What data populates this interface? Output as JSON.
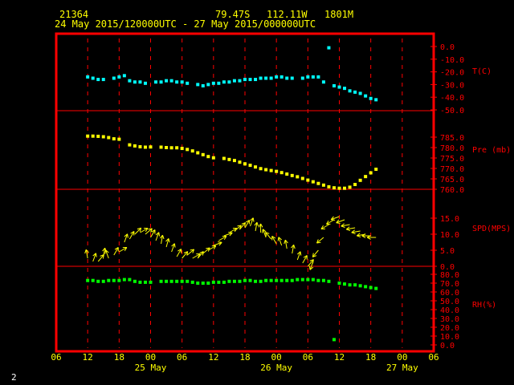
{
  "header": {
    "station": "21364",
    "lat": "79.47S",
    "lon": "112.11W",
    "elev": "1801M",
    "period": "24 May 2015/120000UTC - 27 May 2015/000000UTC"
  },
  "footer_number": "2",
  "colors": {
    "frame": "#ff0000",
    "grid": "#ff0000",
    "axis_text": "#ffff00",
    "temp": "#00ffff",
    "pressure": "#ffff00",
    "wind": "#ffff00",
    "rh": "#00ff00",
    "label_text": "#ff0000"
  },
  "chart_data": [
    {
      "type": "scatter",
      "ylabel": "T(C)",
      "ylim": [
        -50,
        0
      ],
      "yticks": [
        "0.0",
        "-10.0",
        "-20.0",
        "-30.0",
        "-40.0",
        "-50.0"
      ],
      "x": [
        12,
        13,
        14,
        15,
        17,
        18,
        19,
        20,
        21,
        22,
        23,
        25,
        26,
        27,
        28,
        29,
        30,
        31,
        33,
        34,
        35,
        36,
        37,
        38,
        39,
        40,
        41,
        42,
        43,
        44,
        45,
        46,
        47,
        48,
        49,
        50,
        51,
        53,
        54,
        55,
        56,
        57,
        58,
        59,
        60,
        61,
        62,
        63,
        64,
        65,
        66,
        67
      ],
      "y": [
        -24,
        -25,
        -26,
        -26,
        -25,
        -24,
        -23,
        -27,
        -28,
        -28,
        -29,
        -28,
        -28,
        -27,
        -27,
        -28,
        -28,
        -29,
        -30,
        -31,
        -30,
        -29,
        -29,
        -28,
        -28,
        -27,
        -27,
        -26,
        -26,
        -26,
        -25,
        -25,
        -25,
        -24,
        -24,
        -25,
        -25,
        -25,
        -24,
        -24,
        -24,
        -28,
        -1,
        -31,
        -32,
        -33,
        -35,
        -36,
        -37,
        -39,
        -41,
        -42
      ]
    },
    {
      "type": "scatter",
      "ylabel": "Pre (mb)",
      "ylim": [
        760,
        790
      ],
      "yticks": [
        "785.0",
        "780.0",
        "775.0",
        "770.0",
        "765.0",
        "760.0"
      ],
      "x": [
        12,
        13,
        14,
        15,
        16,
        17,
        18,
        20,
        21,
        22,
        23,
        24,
        26,
        27,
        28,
        29,
        30,
        31,
        32,
        33,
        34,
        35,
        36,
        38,
        39,
        40,
        41,
        42,
        43,
        44,
        45,
        46,
        47,
        48,
        49,
        50,
        51,
        52,
        53,
        54,
        55,
        56,
        57,
        58,
        59,
        60,
        61,
        62,
        63,
        64,
        65,
        66,
        67
      ],
      "y": [
        785.5,
        785.5,
        785.4,
        785.2,
        784.8,
        784.2,
        784.0,
        781.3,
        780.8,
        780.4,
        780.2,
        780.3,
        780.2,
        780.0,
        779.9,
        779.9,
        779.6,
        779.1,
        778.4,
        777.5,
        776.6,
        775.7,
        775.1,
        774.8,
        774.3,
        773.8,
        773.0,
        772.2,
        771.5,
        770.7,
        769.9,
        769.4,
        769.0,
        768.6,
        768.0,
        767.3,
        766.6,
        766.0,
        765.2,
        764.4,
        763.6,
        762.8,
        762.0,
        761.2,
        760.7,
        760.5,
        760.5,
        761.0,
        762.3,
        764.3,
        766.1,
        767.9,
        769.6
      ]
    },
    {
      "type": "scatter",
      "ylabel": "SPD(MPS)",
      "ylim": [
        0,
        18
      ],
      "yticks": [
        "15.0",
        "10.0",
        "5.0",
        "0.0"
      ],
      "x": [
        12,
        13,
        14,
        15,
        16,
        17,
        18,
        19,
        20,
        21,
        22,
        23,
        24,
        25,
        26,
        27,
        28,
        29,
        30,
        31,
        32,
        33,
        34,
        35,
        36,
        37,
        38,
        39,
        40,
        41,
        42,
        43,
        44,
        45,
        46,
        47,
        48,
        49,
        50,
        51,
        52,
        53,
        54,
        55,
        56,
        57,
        58,
        59,
        60,
        61,
        62,
        63,
        64,
        65,
        66,
        67
      ],
      "y": [
        2.5,
        1.5,
        1.5,
        3,
        2.5,
        3.5,
        4.5,
        7.5,
        8.5,
        10,
        10.5,
        10,
        9,
        8,
        7,
        6,
        4.5,
        3,
        2.5,
        3.5,
        2.5,
        2.5,
        4,
        5,
        6.5,
        8,
        9.5,
        10.5,
        11,
        11.5,
        12,
        12.5,
        11,
        10.5,
        9,
        8.5,
        7,
        6.5,
        5.5,
        4,
        2,
        1,
        0,
        1.5,
        5,
        9,
        13,
        14.5,
        15.5,
        14.5,
        13,
        12,
        11,
        10,
        9.5,
        9
      ],
      "dir": [
        350,
        20,
        40,
        10,
        340,
        30,
        60,
        20,
        30,
        45,
        60,
        50,
        30,
        20,
        10,
        15,
        20,
        30,
        40,
        50,
        60,
        40,
        50,
        60,
        70,
        60,
        70,
        60,
        50,
        40,
        30,
        20,
        10,
        0,
        340,
        320,
        330,
        340,
        350,
        10,
        20,
        30,
        40,
        200,
        220,
        230,
        240,
        240,
        250,
        250,
        260,
        260,
        260,
        260,
        270,
        270
      ]
    },
    {
      "type": "scatter",
      "ylabel": "RH(%)",
      "ylim": [
        0,
        80
      ],
      "yticks": [
        "80.0",
        "70.0",
        "60.0",
        "50.0",
        "40.0",
        "30.0",
        "20.0",
        "10.0",
        "0.0"
      ],
      "x": [
        12,
        13,
        14,
        15,
        16,
        17,
        18,
        19,
        20,
        21,
        22,
        23,
        24,
        26,
        27,
        28,
        29,
        30,
        31,
        32,
        33,
        34,
        35,
        36,
        37,
        38,
        39,
        40,
        41,
        42,
        43,
        44,
        45,
        46,
        47,
        48,
        49,
        50,
        51,
        52,
        53,
        54,
        55,
        56,
        57,
        58,
        59,
        60,
        61,
        62,
        63,
        64,
        65,
        66,
        67
      ],
      "y": [
        73,
        73,
        72,
        72,
        73,
        73,
        73,
        74,
        74,
        72,
        71,
        71,
        71,
        72,
        72,
        72,
        72,
        72,
        72,
        71,
        70,
        70,
        70,
        71,
        71,
        71,
        72,
        72,
        72,
        73,
        73,
        72,
        72,
        73,
        73,
        73,
        73,
        73,
        73,
        74,
        74,
        74,
        74,
        73,
        73,
        72,
        6,
        70,
        69,
        68,
        68,
        67,
        66,
        65,
        64
      ]
    }
  ],
  "x_axis": {
    "ticks": [
      "06",
      "12",
      "18",
      "00",
      "06",
      "12",
      "18",
      "00",
      "06",
      "12",
      "18",
      "00",
      "06"
    ],
    "days": [
      "25 May",
      "26 May",
      "27 May"
    ]
  }
}
